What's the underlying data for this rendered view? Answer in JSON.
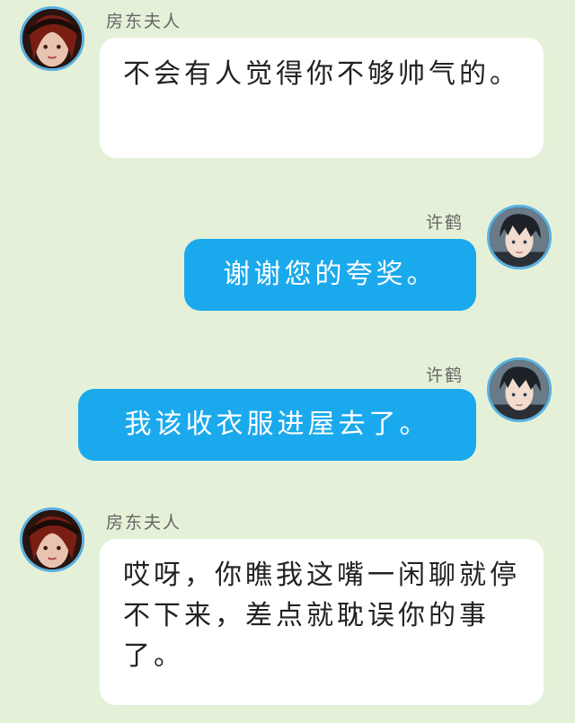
{
  "messages": [
    {
      "sender": "房东夫人",
      "side": "left",
      "text": "不会有人觉得你不够帅气的。"
    },
    {
      "sender": "许鹤",
      "side": "right",
      "text": "谢谢您的夸奖。"
    },
    {
      "sender": "许鹤",
      "side": "right",
      "text": "我该收衣服进屋去了。"
    },
    {
      "sender": "房东夫人",
      "side": "left",
      "text": "哎呀，你瞧我这嘴一闲聊就停不下来，差点就耽误你的事了。"
    }
  ],
  "colors": {
    "background": "#e4f1d8",
    "outgoing_bubble": "#1aa9ed",
    "incoming_bubble": "#ffffff",
    "avatar_border": "#5ab0e0"
  }
}
